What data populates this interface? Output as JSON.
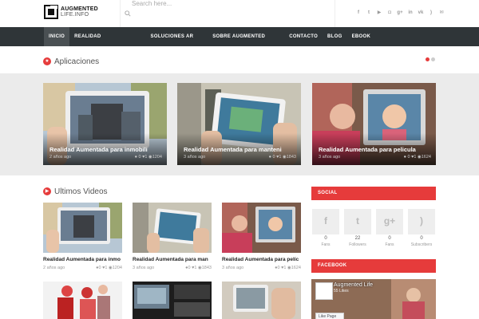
{
  "brand": {
    "line1": "AUGMENTED",
    "line2": "LIFE.INFO"
  },
  "search": {
    "placeholder": "Search here..."
  },
  "social_icons": [
    "facebook-icon",
    "twitter-icon",
    "youtube-icon",
    "instagram-icon",
    "googleplus-icon",
    "linkedin-icon",
    "vk-icon",
    "rss-icon",
    "email-icon"
  ],
  "nav": [
    "INICIO",
    "REALIDAD",
    "SOLUCIONES AR",
    "SOBRE AUGMENTED",
    "CONTACTO",
    "BLOG",
    "EBOOK"
  ],
  "apps": {
    "title": "Aplicaciones",
    "cards": [
      {
        "title": "Realidad Aumentada para inmobili",
        "date": "2 años ago",
        "comments": "0",
        "likes": "1",
        "views": "1204"
      },
      {
        "title": "Realidad Aumentada para manteni",
        "date": "3 años ago",
        "comments": "0",
        "likes": "1",
        "views": "1843"
      },
      {
        "title": "Realidad Aumentada para pelicula",
        "date": "3 años ago",
        "comments": "0",
        "likes": "1",
        "views": "1624"
      }
    ]
  },
  "videos": {
    "title": "Ultimos Videos",
    "items": [
      {
        "title": "Realidad Aumentada para inmo",
        "date": "2 años ago",
        "comments": "0",
        "likes": "1",
        "views": "1204"
      },
      {
        "title": "Realidad Aumentada para man",
        "date": "3 años ago",
        "comments": "0",
        "likes": "1",
        "views": "1843"
      },
      {
        "title": "Realidad Aumentada para pelíc",
        "date": "3 años ago",
        "comments": "0",
        "likes": "1",
        "views": "1624"
      }
    ]
  },
  "social": {
    "heading": "SOCIAL",
    "items": [
      {
        "icon": "facebook-icon",
        "glyph": "f",
        "count": "0",
        "label": "Fans"
      },
      {
        "icon": "twitter-icon",
        "glyph": "t",
        "count": "22",
        "label": "Followers"
      },
      {
        "icon": "googleplus-icon",
        "glyph": "g+",
        "count": "0",
        "label": "Fans"
      },
      {
        "icon": "rss-icon",
        "glyph": ")",
        "count": "0",
        "label": "Subscribers"
      }
    ]
  },
  "facebook": {
    "heading": "FACEBOOK",
    "page_name": "Augmented Life",
    "likes": "55 Likes",
    "like_button": "Like Page"
  },
  "colors": {
    "accent": "#e63b3b",
    "nav_bg": "#2f3538",
    "band_bg": "#ebebeb"
  }
}
